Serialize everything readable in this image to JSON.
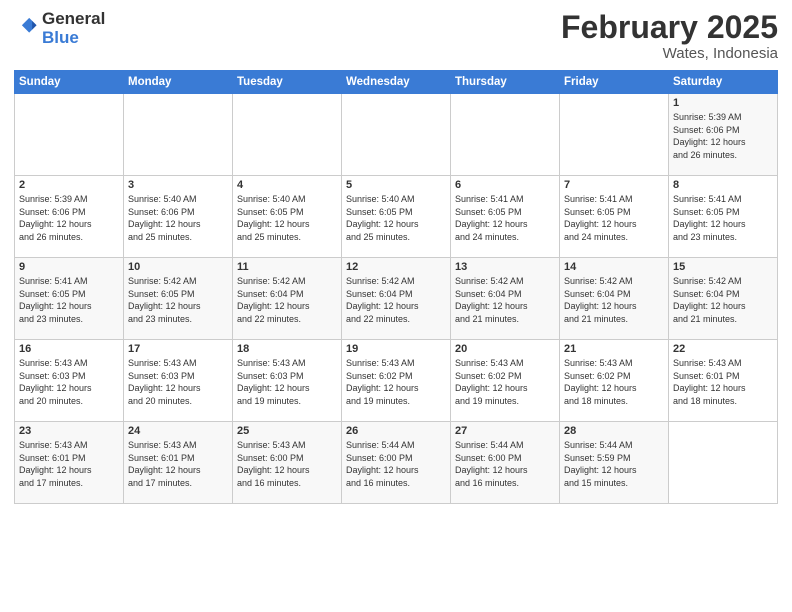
{
  "logo": {
    "line1": "General",
    "line2": "Blue"
  },
  "header": {
    "month": "February 2025",
    "location": "Wates, Indonesia"
  },
  "weekdays": [
    "Sunday",
    "Monday",
    "Tuesday",
    "Wednesday",
    "Thursday",
    "Friday",
    "Saturday"
  ],
  "weeks": [
    [
      {
        "day": "",
        "info": ""
      },
      {
        "day": "",
        "info": ""
      },
      {
        "day": "",
        "info": ""
      },
      {
        "day": "",
        "info": ""
      },
      {
        "day": "",
        "info": ""
      },
      {
        "day": "",
        "info": ""
      },
      {
        "day": "1",
        "info": "Sunrise: 5:39 AM\nSunset: 6:06 PM\nDaylight: 12 hours\nand 26 minutes."
      }
    ],
    [
      {
        "day": "2",
        "info": "Sunrise: 5:39 AM\nSunset: 6:06 PM\nDaylight: 12 hours\nand 26 minutes."
      },
      {
        "day": "3",
        "info": "Sunrise: 5:40 AM\nSunset: 6:06 PM\nDaylight: 12 hours\nand 25 minutes."
      },
      {
        "day": "4",
        "info": "Sunrise: 5:40 AM\nSunset: 6:05 PM\nDaylight: 12 hours\nand 25 minutes."
      },
      {
        "day": "5",
        "info": "Sunrise: 5:40 AM\nSunset: 6:05 PM\nDaylight: 12 hours\nand 25 minutes."
      },
      {
        "day": "6",
        "info": "Sunrise: 5:41 AM\nSunset: 6:05 PM\nDaylight: 12 hours\nand 24 minutes."
      },
      {
        "day": "7",
        "info": "Sunrise: 5:41 AM\nSunset: 6:05 PM\nDaylight: 12 hours\nand 24 minutes."
      },
      {
        "day": "8",
        "info": "Sunrise: 5:41 AM\nSunset: 6:05 PM\nDaylight: 12 hours\nand 23 minutes."
      }
    ],
    [
      {
        "day": "9",
        "info": "Sunrise: 5:41 AM\nSunset: 6:05 PM\nDaylight: 12 hours\nand 23 minutes."
      },
      {
        "day": "10",
        "info": "Sunrise: 5:42 AM\nSunset: 6:05 PM\nDaylight: 12 hours\nand 23 minutes."
      },
      {
        "day": "11",
        "info": "Sunrise: 5:42 AM\nSunset: 6:04 PM\nDaylight: 12 hours\nand 22 minutes."
      },
      {
        "day": "12",
        "info": "Sunrise: 5:42 AM\nSunset: 6:04 PM\nDaylight: 12 hours\nand 22 minutes."
      },
      {
        "day": "13",
        "info": "Sunrise: 5:42 AM\nSunset: 6:04 PM\nDaylight: 12 hours\nand 21 minutes."
      },
      {
        "day": "14",
        "info": "Sunrise: 5:42 AM\nSunset: 6:04 PM\nDaylight: 12 hours\nand 21 minutes."
      },
      {
        "day": "15",
        "info": "Sunrise: 5:42 AM\nSunset: 6:04 PM\nDaylight: 12 hours\nand 21 minutes."
      }
    ],
    [
      {
        "day": "16",
        "info": "Sunrise: 5:43 AM\nSunset: 6:03 PM\nDaylight: 12 hours\nand 20 minutes."
      },
      {
        "day": "17",
        "info": "Sunrise: 5:43 AM\nSunset: 6:03 PM\nDaylight: 12 hours\nand 20 minutes."
      },
      {
        "day": "18",
        "info": "Sunrise: 5:43 AM\nSunset: 6:03 PM\nDaylight: 12 hours\nand 19 minutes."
      },
      {
        "day": "19",
        "info": "Sunrise: 5:43 AM\nSunset: 6:02 PM\nDaylight: 12 hours\nand 19 minutes."
      },
      {
        "day": "20",
        "info": "Sunrise: 5:43 AM\nSunset: 6:02 PM\nDaylight: 12 hours\nand 19 minutes."
      },
      {
        "day": "21",
        "info": "Sunrise: 5:43 AM\nSunset: 6:02 PM\nDaylight: 12 hours\nand 18 minutes."
      },
      {
        "day": "22",
        "info": "Sunrise: 5:43 AM\nSunset: 6:01 PM\nDaylight: 12 hours\nand 18 minutes."
      }
    ],
    [
      {
        "day": "23",
        "info": "Sunrise: 5:43 AM\nSunset: 6:01 PM\nDaylight: 12 hours\nand 17 minutes."
      },
      {
        "day": "24",
        "info": "Sunrise: 5:43 AM\nSunset: 6:01 PM\nDaylight: 12 hours\nand 17 minutes."
      },
      {
        "day": "25",
        "info": "Sunrise: 5:43 AM\nSunset: 6:00 PM\nDaylight: 12 hours\nand 16 minutes."
      },
      {
        "day": "26",
        "info": "Sunrise: 5:44 AM\nSunset: 6:00 PM\nDaylight: 12 hours\nand 16 minutes."
      },
      {
        "day": "27",
        "info": "Sunrise: 5:44 AM\nSunset: 6:00 PM\nDaylight: 12 hours\nand 16 minutes."
      },
      {
        "day": "28",
        "info": "Sunrise: 5:44 AM\nSunset: 5:59 PM\nDaylight: 12 hours\nand 15 minutes."
      },
      {
        "day": "",
        "info": ""
      }
    ]
  ]
}
